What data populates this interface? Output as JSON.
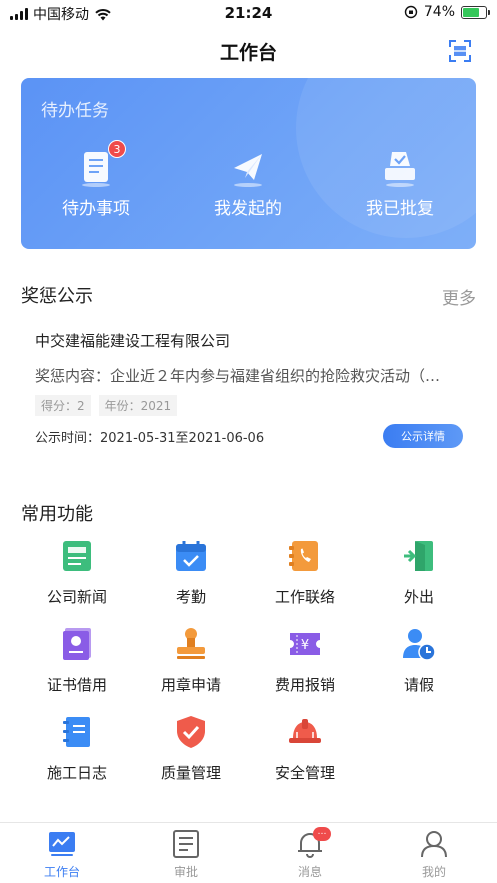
{
  "status_bar": {
    "carrier": "中国移动",
    "time": "21:24",
    "battery": "74%",
    "battery_level": 0.74
  },
  "nav": {
    "title": "工作台",
    "scan_icon": "scan-icon"
  },
  "todo": {
    "title": "待办任务",
    "items": [
      {
        "label": "待办事项",
        "icon": "document-list-icon",
        "badge": "3"
      },
      {
        "label": "我发起的",
        "icon": "paper-plane-icon"
      },
      {
        "label": "我已批复",
        "icon": "ballot-box-icon"
      }
    ]
  },
  "rewards": {
    "title": "奖惩公示",
    "more": "更多",
    "entry": {
      "company": "中交建福能建设工程有限公司",
      "content": "奖惩内容：企业近２年内参与福建省组织的抢险救灾活动（…",
      "score": "得分：2",
      "year": "年份：2021",
      "period": "公示时间：2021-05-31至2021-06-06",
      "detail_button": "公示详情"
    }
  },
  "functions": {
    "title": "常用功能",
    "items": [
      {
        "label": "公司新闻",
        "icon": "news-icon",
        "color": "#3dbd7d"
      },
      {
        "label": "考勤",
        "icon": "calendar-check-icon",
        "color": "#3b8cf5"
      },
      {
        "label": "工作联络",
        "icon": "phone-book-icon",
        "color": "#f39a3c"
      },
      {
        "label": "外出",
        "icon": "exit-door-icon",
        "color": "#3dbd7d"
      },
      {
        "label": "证书借用",
        "icon": "certificate-icon",
        "color": "#8a5ce6"
      },
      {
        "label": "用章申请",
        "icon": "stamp-icon",
        "color": "#f39a3c"
      },
      {
        "label": "费用报销",
        "icon": "expense-ticket-icon",
        "color": "#8a5ce6"
      },
      {
        "label": "请假",
        "icon": "user-clock-icon",
        "color": "#3b8cf5"
      },
      {
        "label": "施工日志",
        "icon": "notebook-icon",
        "color": "#3b8cf5"
      },
      {
        "label": "质量管理",
        "icon": "shield-check-icon",
        "color": "#ef5b4b"
      },
      {
        "label": "安全管理",
        "icon": "hard-hat-icon",
        "color": "#ef5b4b"
      }
    ]
  },
  "tab_bar": {
    "tabs": [
      {
        "label": "工作台",
        "icon": "chart-board-icon",
        "active": true
      },
      {
        "label": "审批",
        "icon": "approval-doc-icon"
      },
      {
        "label": "消息",
        "icon": "bell-icon",
        "badge": "…"
      },
      {
        "label": "我的",
        "icon": "person-icon"
      }
    ]
  },
  "colors": {
    "accent": "#3b7df2",
    "card_gradient_start": "#5b93f5",
    "card_gradient_end": "#7eaff8",
    "badge_red": "#ef4b4b"
  }
}
